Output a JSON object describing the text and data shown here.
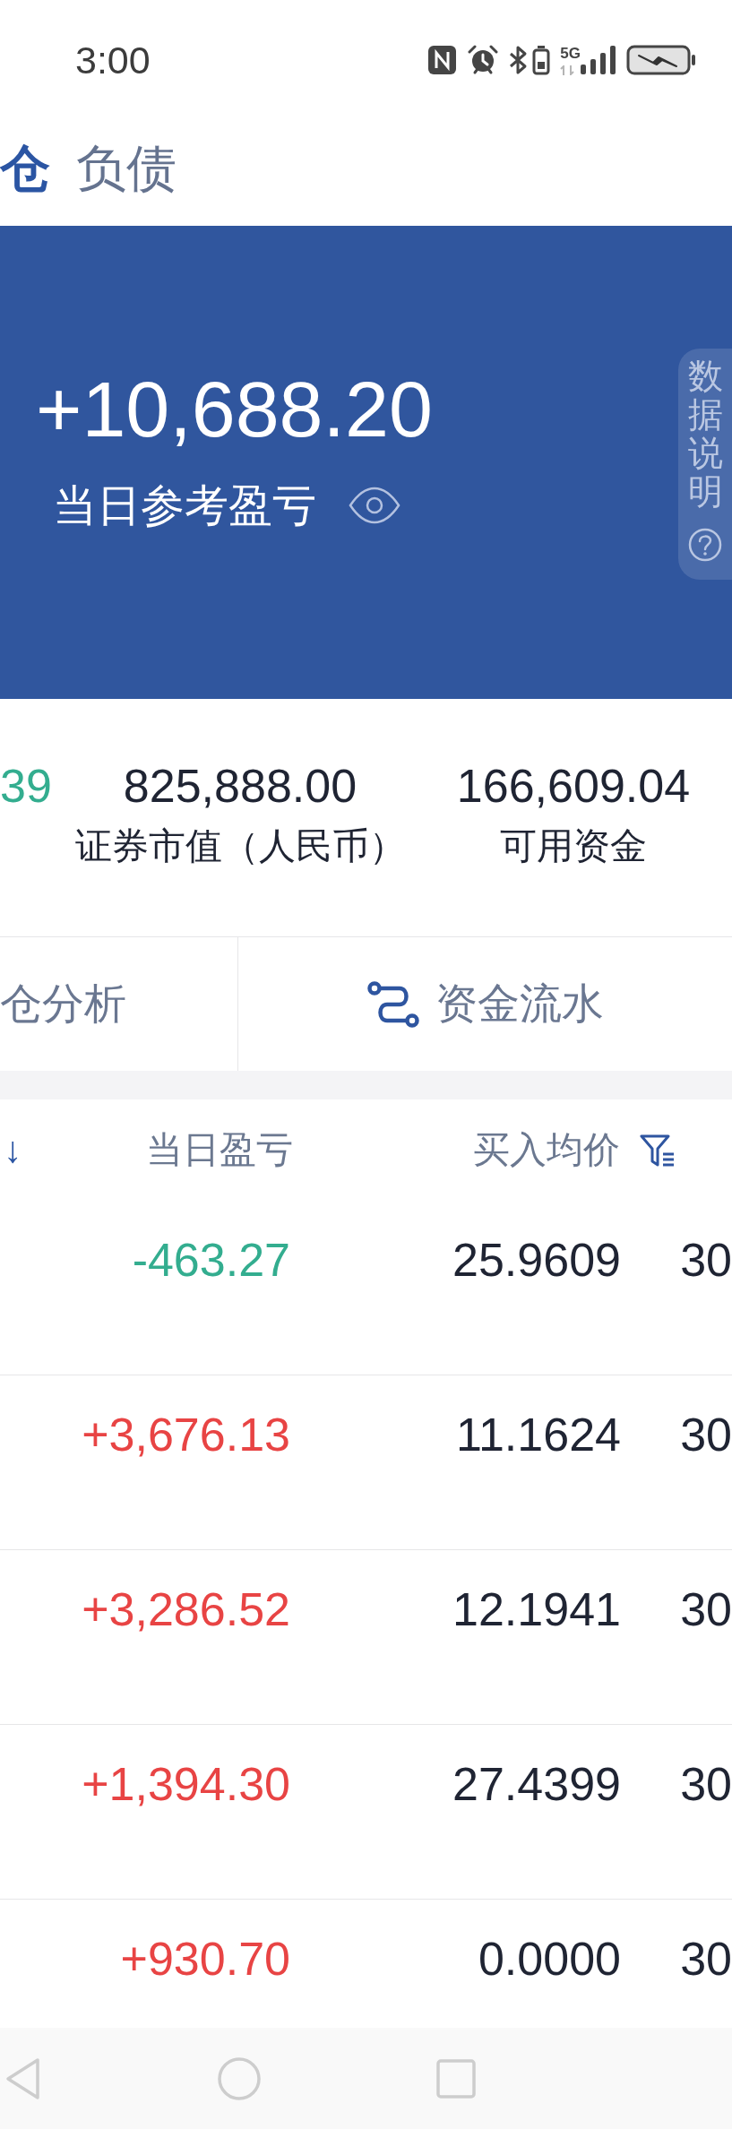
{
  "status_bar": {
    "time": "3:00",
    "network": "5G"
  },
  "tabs": [
    {
      "label": "仓",
      "selected": true
    },
    {
      "label": "负债",
      "selected": false
    }
  ],
  "summary": {
    "value": "+10,688.20",
    "label": "当日参考盈亏",
    "info_tab": "数据说明"
  },
  "stats": [
    {
      "value": "39",
      "color": "#33ad8f"
    },
    {
      "value": "825,888.00",
      "label": "证券市值（人民币）",
      "color": "#1f2433"
    },
    {
      "value": "166,609.04",
      "label": "可用资金",
      "color": "#1f2433"
    }
  ],
  "actions": [
    {
      "label": "仓分析",
      "kind": "text"
    },
    {
      "label": "资金流水",
      "kind": "icon-text"
    }
  ],
  "table": {
    "columns": [
      {
        "label": "↓",
        "sorted": true,
        "filter": false
      },
      {
        "label": "当日盈亏",
        "sorted": false,
        "filter": false
      },
      {
        "label": "买入均价",
        "sorted": false,
        "filter": true
      }
    ],
    "rows": [
      {
        "daily_pnl": "-463.27",
        "color": "#33ad8f",
        "avg_price": "25.9609",
        "column_4": "30"
      },
      {
        "daily_pnl": "+3,676.13",
        "color": "#e84444",
        "avg_price": "11.1624",
        "column_4": "30"
      },
      {
        "daily_pnl": "+3,286.52",
        "color": "#e84444",
        "avg_price": "12.1941",
        "column_4": "30"
      },
      {
        "daily_pnl": "+1,394.30",
        "color": "#e84444",
        "avg_price": "27.4399",
        "column_4": "30"
      },
      {
        "daily_pnl": "+930.70",
        "color": "#e84444",
        "avg_price": "0.0000",
        "column_4": "30"
      }
    ]
  }
}
